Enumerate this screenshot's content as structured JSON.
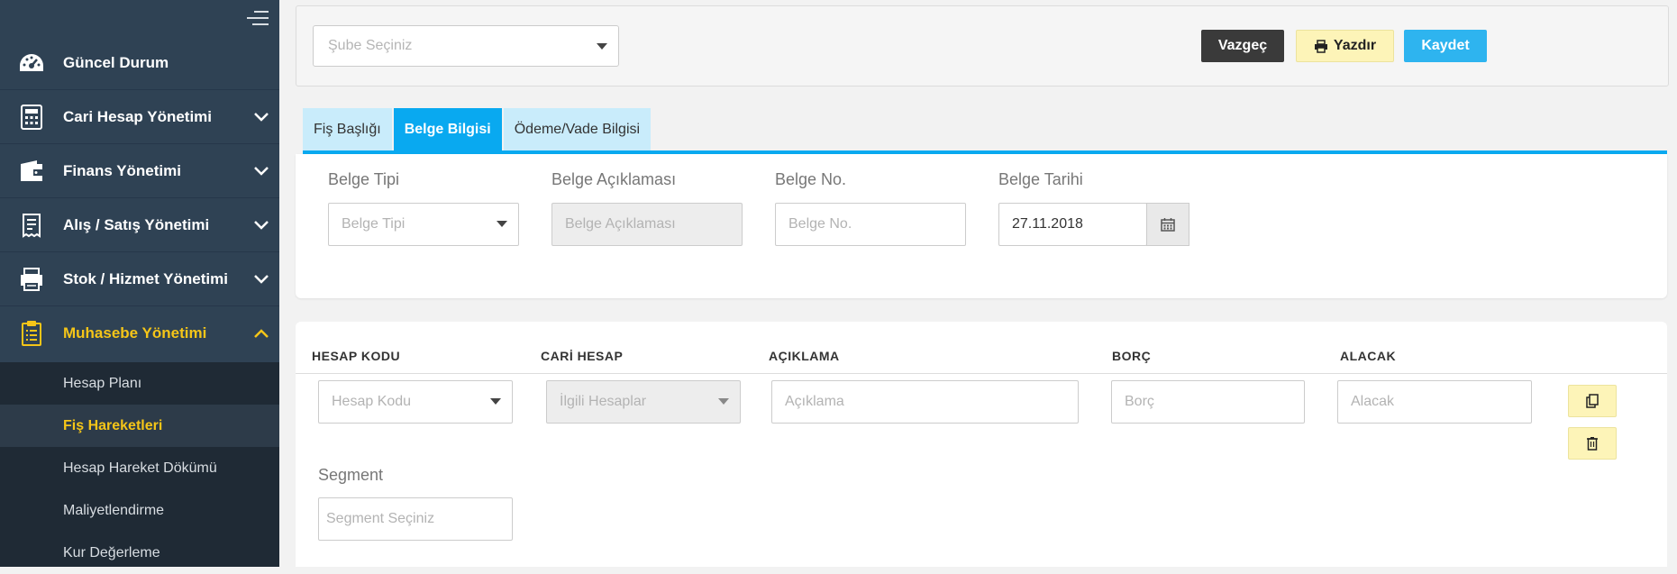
{
  "sidebar": {
    "items": [
      {
        "label": "Güncel Durum",
        "icon": "dashboard-icon",
        "has_chevron": false
      },
      {
        "label": "Cari Hesap Yönetimi",
        "icon": "calculator-icon",
        "has_chevron": true
      },
      {
        "label": "Finans Yönetimi",
        "icon": "wallet-icon",
        "has_chevron": true
      },
      {
        "label": "Alış / Satış Yönetimi",
        "icon": "receipt-icon",
        "has_chevron": true
      },
      {
        "label": "Stok / Hizmet Yönetimi",
        "icon": "printer-box-icon",
        "has_chevron": true
      },
      {
        "label": "Muhasebe Yönetimi",
        "icon": "clipboard-icon",
        "has_chevron": true,
        "active": true
      }
    ],
    "submenu": [
      {
        "label": "Hesap Planı"
      },
      {
        "label": "Fiş Hareketleri",
        "active": true
      },
      {
        "label": "Hesap Hareket Dökümü"
      },
      {
        "label": "Maliyetlendirme"
      },
      {
        "label": "Kur Değerleme"
      }
    ],
    "accent_color": "#f5c518"
  },
  "topbar": {
    "branch_placeholder": "Şube Seçiniz",
    "cancel_label": "Vazgeç",
    "print_label": "Yazdır",
    "save_label": "Kaydet"
  },
  "tabs": [
    {
      "label": "Fiş Başlığı"
    },
    {
      "label": "Belge Bilgisi",
      "active": true
    },
    {
      "label": "Ödeme/Vade Bilgisi"
    }
  ],
  "document": {
    "type_label": "Belge Tipi",
    "type_placeholder": "Belge Tipi",
    "desc_label": "Belge Açıklaması",
    "desc_placeholder": "Belge Açıklaması",
    "no_label": "Belge No.",
    "no_placeholder": "Belge No.",
    "date_label": "Belge Tarihi",
    "date_value": "27.11.2018"
  },
  "lines": {
    "headers": [
      "HESAP KODU",
      "CARİ HESAP",
      "AÇIKLAMA",
      "BORÇ",
      "ALACAK"
    ],
    "account_code_placeholder": "Hesap Kodu",
    "related_accounts_placeholder": "İlgili Hesaplar",
    "description_placeholder": "Açıklama",
    "debit_placeholder": "Borç",
    "credit_placeholder": "Alacak",
    "segment_label": "Segment",
    "segment_placeholder": "Segment Seçiniz"
  },
  "colors": {
    "primary": "#09a9f0",
    "sidebar_bg": "#2f4254",
    "highlight": "#fdf4b8"
  }
}
